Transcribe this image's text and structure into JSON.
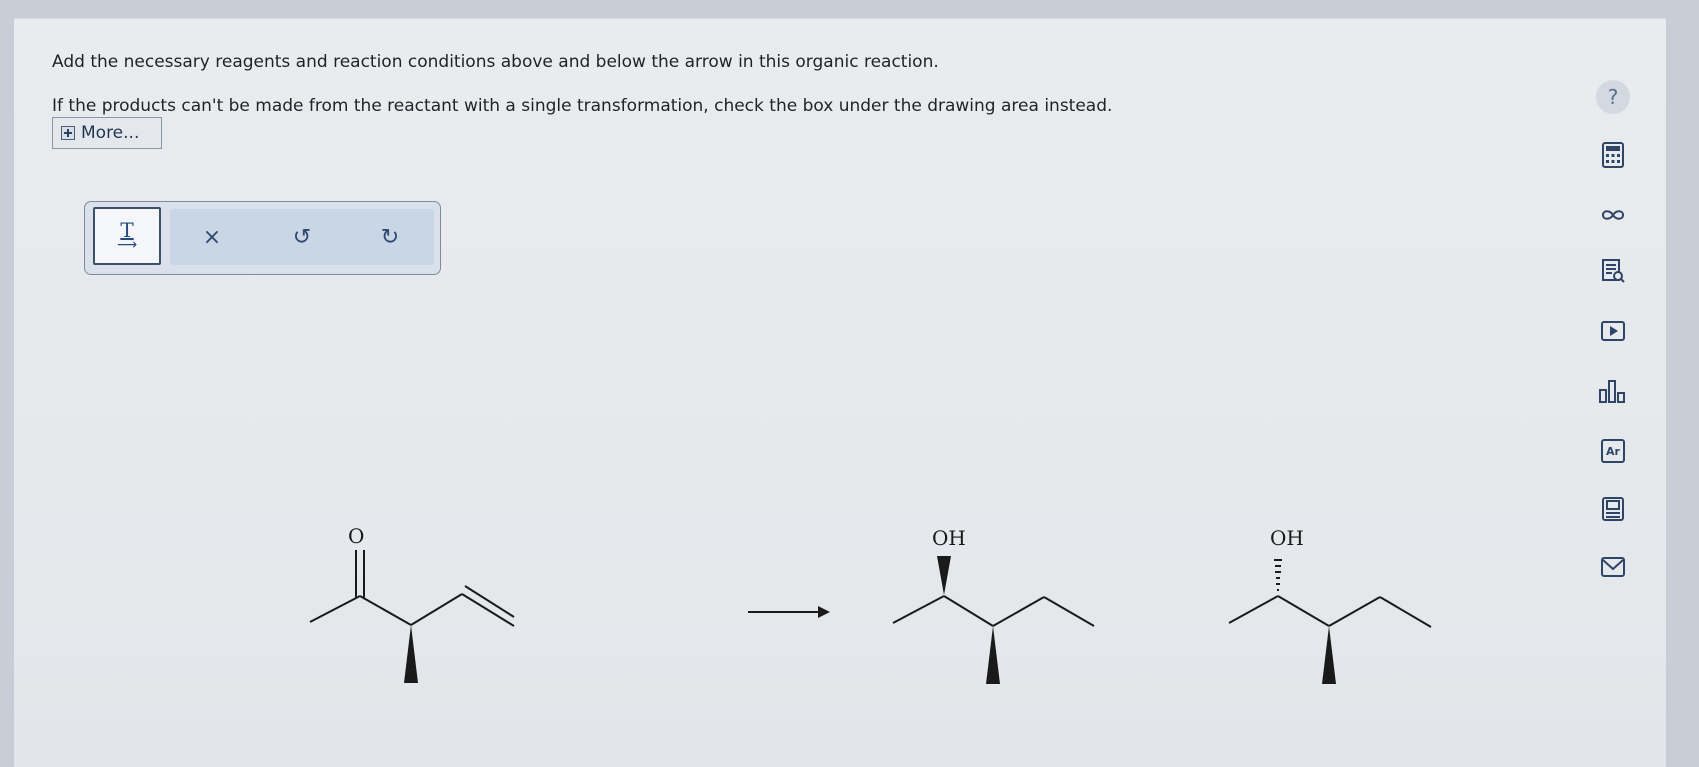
{
  "instructions": {
    "line1": "Add the necessary reagents and reaction conditions above and below the arrow in this organic reaction.",
    "line2": "If the products can't be made from the reactant with a single transformation, check the box under the drawing area instead.",
    "more_label": "More..."
  },
  "toolbar": {
    "text_tool_label": "T",
    "clear_symbol": "×",
    "undo_symbol": "↺",
    "redo_symbol": "↻"
  },
  "sidebar": {
    "help_symbol": "?",
    "periodic_label": "Ar"
  },
  "reaction": {
    "reactant_atom_label": "O",
    "product1_atom_label": "OH",
    "product2_atom_label": "OH"
  },
  "colors": {
    "accent": "#2e4568",
    "panel": "#e8ebee",
    "toolbar_group": "#c8d6e6"
  }
}
